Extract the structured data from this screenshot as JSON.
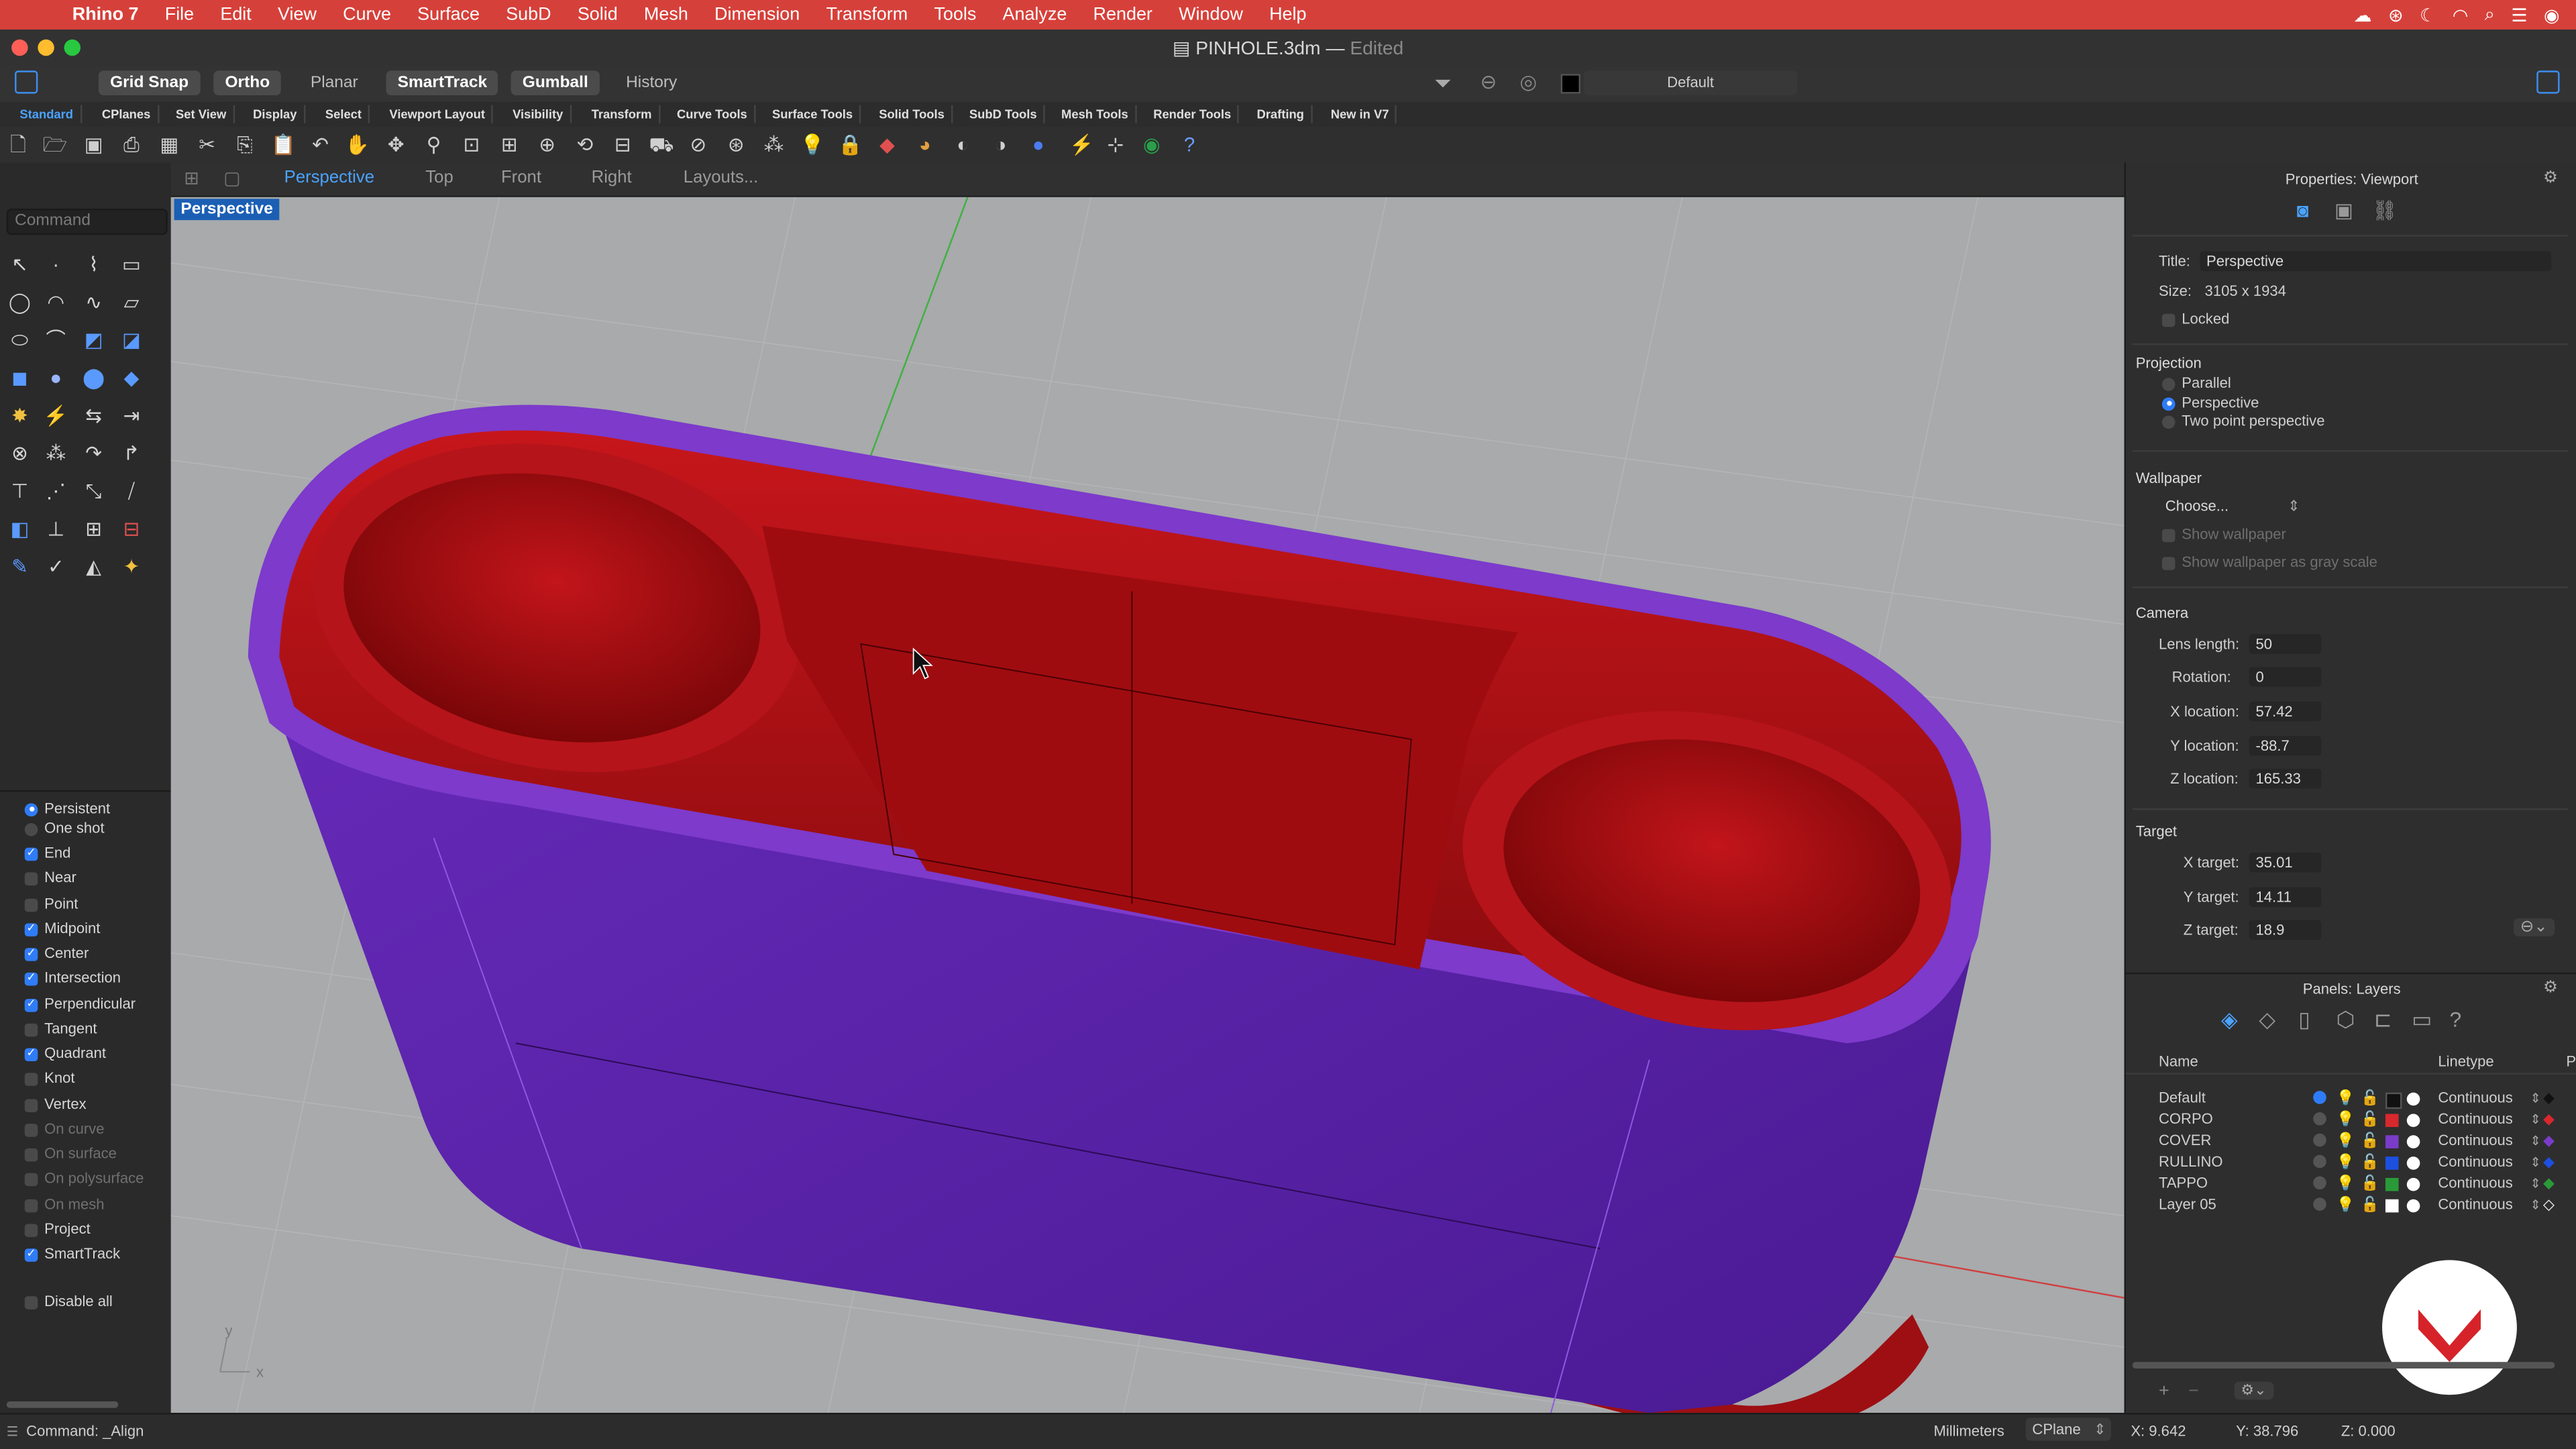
{
  "menubar": {
    "app": "Rhino 7",
    "items": [
      "File",
      "Edit",
      "View",
      "Curve",
      "Surface",
      "SubD",
      "Solid",
      "Mesh",
      "Dimension",
      "Transform",
      "Tools",
      "Analyze",
      "Render",
      "Window",
      "Help"
    ]
  },
  "titlebar": {
    "filename": "PINHOLE.3dm",
    "status": "Edited"
  },
  "toggles": {
    "grid_snap": "Grid Snap",
    "ortho": "Ortho",
    "planar": "Planar",
    "smarttrack": "SmartTrack",
    "gumball": "Gumball",
    "history": "History",
    "layer_current": "Default"
  },
  "tabs": [
    "Standard",
    "CPlanes",
    "Set View",
    "Display",
    "Select",
    "Viewport Layout",
    "Visibility",
    "Transform",
    "Curve Tools",
    "Surface Tools",
    "Solid Tools",
    "SubD Tools",
    "Mesh Tools",
    "Render Tools",
    "Drafting",
    "New in V7"
  ],
  "viewport_tabs": {
    "perspective": "Perspective",
    "top": "Top",
    "front": "Front",
    "right": "Right",
    "layouts": "Layouts..."
  },
  "command": {
    "placeholder": "Command",
    "status": "Command: _Align"
  },
  "viewport": {
    "label": "Perspective"
  },
  "osnap": {
    "persistent": "Persistent",
    "one_shot": "One shot",
    "items": [
      {
        "label": "End",
        "checked": true
      },
      {
        "label": "Near",
        "checked": false
      },
      {
        "label": "Point",
        "checked": false
      },
      {
        "label": "Midpoint",
        "checked": true
      },
      {
        "label": "Center",
        "checked": true
      },
      {
        "label": "Intersection",
        "checked": true
      },
      {
        "label": "Perpendicular",
        "checked": true
      },
      {
        "label": "Tangent",
        "checked": false
      },
      {
        "label": "Quadrant",
        "checked": true
      },
      {
        "label": "Knot",
        "checked": false
      },
      {
        "label": "Vertex",
        "checked": false
      },
      {
        "label": "On curve",
        "checked": false
      },
      {
        "label": "On surface",
        "checked": false
      },
      {
        "label": "On polysurface",
        "checked": false
      },
      {
        "label": "On mesh",
        "checked": false
      },
      {
        "label": "Project",
        "checked": false
      },
      {
        "label": "SmartTrack",
        "checked": true
      }
    ],
    "disable_all": "Disable all"
  },
  "properties": {
    "header": "Properties: Viewport",
    "title_label": "Title:",
    "title_value": "Perspective",
    "size_label": "Size:",
    "size_value": "3105 x 1934",
    "locked": "Locked",
    "projection": "Projection",
    "parallel": "Parallel",
    "perspective": "Perspective",
    "two_point": "Two point perspective",
    "wallpaper": "Wallpaper",
    "choose": "Choose...",
    "show_wallpaper": "Show wallpaper",
    "gray_scale": "Show wallpaper as gray scale",
    "camera": "Camera",
    "lens_label": "Lens length:",
    "lens": "50",
    "rotation_label": "Rotation:",
    "rotation": "0",
    "xloc_label": "X location:",
    "xloc": "57.42",
    "yloc_label": "Y location:",
    "yloc": "-88.7",
    "zloc_label": "Z location:",
    "zloc": "165.33",
    "target": "Target",
    "xt_label": "X target:",
    "xt": "35.01",
    "yt_label": "Y target:",
    "yt": "14.11",
    "zt_label": "Z target:",
    "zt": "18.9"
  },
  "layers": {
    "header": "Panels: Layers",
    "col_name": "Name",
    "col_linetype": "Linetype",
    "col_p": "P",
    "rows": [
      {
        "name": "Default",
        "linetype": "Continuous",
        "color": "#111111",
        "current": true
      },
      {
        "name": "CORPO",
        "linetype": "Continuous",
        "color": "#d7282e",
        "current": false
      },
      {
        "name": "COVER",
        "linetype": "Continuous",
        "color": "#7a3cc8",
        "current": false
      },
      {
        "name": "RULLINO",
        "linetype": "Continuous",
        "color": "#1d4fe0",
        "current": false
      },
      {
        "name": "TAPPO",
        "linetype": "Continuous",
        "color": "#2a9a38",
        "current": false
      },
      {
        "name": "Layer 05",
        "linetype": "Continuous",
        "color": "#ffffff",
        "current": false
      }
    ]
  },
  "status": {
    "units": "Millimeters",
    "cplane": "CPlane",
    "x": "X: 9.642",
    "y": "Y: 38.796",
    "z": "Z: 0.000"
  },
  "colors": {
    "menubar": "#d6403a",
    "accent": "#2f7cf6",
    "body": "#5a1fa0",
    "inner": "#b10f12"
  }
}
